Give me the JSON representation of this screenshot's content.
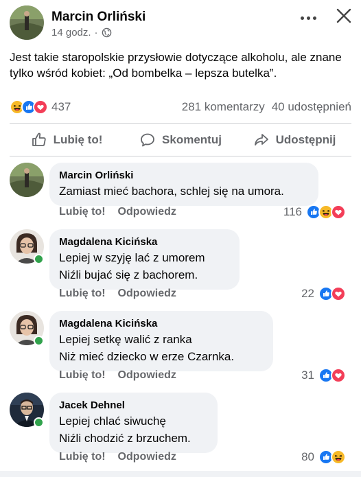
{
  "post": {
    "author": "Marcin Orliński",
    "time": "14 godz.",
    "separator": "·",
    "text": "Jest takie staropolskie przysłowie dotyczące alkoholu, ale znane tylko wśród kobiet: „Od bombelka – lepsza butelka”.",
    "reaction_count": "437",
    "comments_count": "281 komentarzy",
    "shares_count": "40 udostępnień"
  },
  "actions": {
    "like": "Lubię to!",
    "comment": "Skomentuj",
    "share": "Udostępnij"
  },
  "comments": [
    {
      "author": "Marcin Orliński",
      "lines": [
        "Zamiast mieć bachora, schlej się na umora."
      ],
      "like": "Lubię to!",
      "reply": "Odpowiedz",
      "count": "116",
      "online": false
    },
    {
      "author": "Magdalena Kicińska",
      "lines": [
        "Lepiej w szyję lać z umorem",
        "Niźli bujać się z bachorem."
      ],
      "like": "Lubię to!",
      "reply": "Odpowiedz",
      "count": "22",
      "online": true
    },
    {
      "author": "Magdalena Kicińska",
      "lines": [
        "Lepiej setkę walić z ranka",
        "Niż mieć dziecko w erze Czarnka."
      ],
      "like": "Lubię to!",
      "reply": "Odpowiedz",
      "count": "31",
      "online": true
    },
    {
      "author": "Jacek Dehnel",
      "lines": [
        "Lepiej chlać siwuchę",
        "Niźli chodzić z brzuchem."
      ],
      "like": "Lubię to!",
      "reply": "Odpowiedz",
      "count": "80",
      "online": true
    }
  ],
  "colors": {
    "like_blue": "#1877f2",
    "love_red": "#f33e58",
    "haha_yellow": "#f7b928",
    "secondary_text": "#65676b",
    "bubble_bg": "#f0f2f5",
    "online_green": "#31a24c"
  },
  "icons": [
    "globe-icon",
    "more-icon",
    "close-icon",
    "like-icon",
    "comment-icon",
    "share-icon",
    "haha-icon",
    "love-icon"
  ]
}
